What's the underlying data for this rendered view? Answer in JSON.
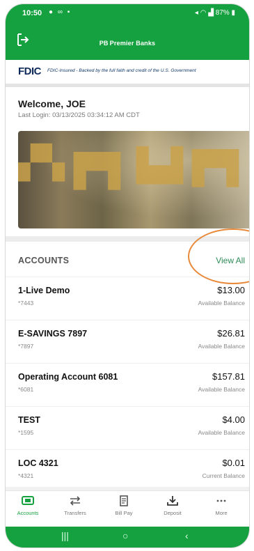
{
  "status_bar": {
    "time": "10:50",
    "battery": "87%"
  },
  "header": {
    "brand": "Premier Banks",
    "brand_mark": "PB"
  },
  "fdic": {
    "logo": "FDIC",
    "tagline": "FDIC-Insured - Backed by the full faith and credit of the U.S. Government"
  },
  "welcome": {
    "greeting": "Welcome, JOE",
    "last_login": "Last Login: 03/13/2025 03:34:12 AM CDT"
  },
  "accounts": {
    "title": "ACCOUNTS",
    "view_all": "View All",
    "items": [
      {
        "name": "1-Live Demo",
        "number": "*7443",
        "balance": "$13.00",
        "balance_label": "Available Balance"
      },
      {
        "name": "E-SAVINGS 7897",
        "number": "*7897",
        "balance": "$26.81",
        "balance_label": "Available Balance"
      },
      {
        "name": "Operating Account 6081",
        "number": "*6081",
        "balance": "$157.81",
        "balance_label": "Available Balance"
      },
      {
        "name": "TEST",
        "number": "*1595",
        "balance": "$4.00",
        "balance_label": "Available Balance"
      },
      {
        "name": "LOC 4321",
        "number": "*4321",
        "balance": "$0.01",
        "balance_label": "Current Balance"
      }
    ]
  },
  "tabs": [
    {
      "label": "Accounts",
      "icon": "accounts-icon",
      "active": true
    },
    {
      "label": "Transfers",
      "icon": "transfer-arrows-icon",
      "active": false
    },
    {
      "label": "Bill Pay",
      "icon": "bill-icon",
      "active": false
    },
    {
      "label": "Deposit",
      "icon": "deposit-icon",
      "active": false
    },
    {
      "label": "More",
      "icon": "more-dots-icon",
      "active": false
    }
  ],
  "colors": {
    "brand_green": "#15a13f",
    "link_green": "#2e8b57",
    "annotation_orange": "#e8893a"
  }
}
